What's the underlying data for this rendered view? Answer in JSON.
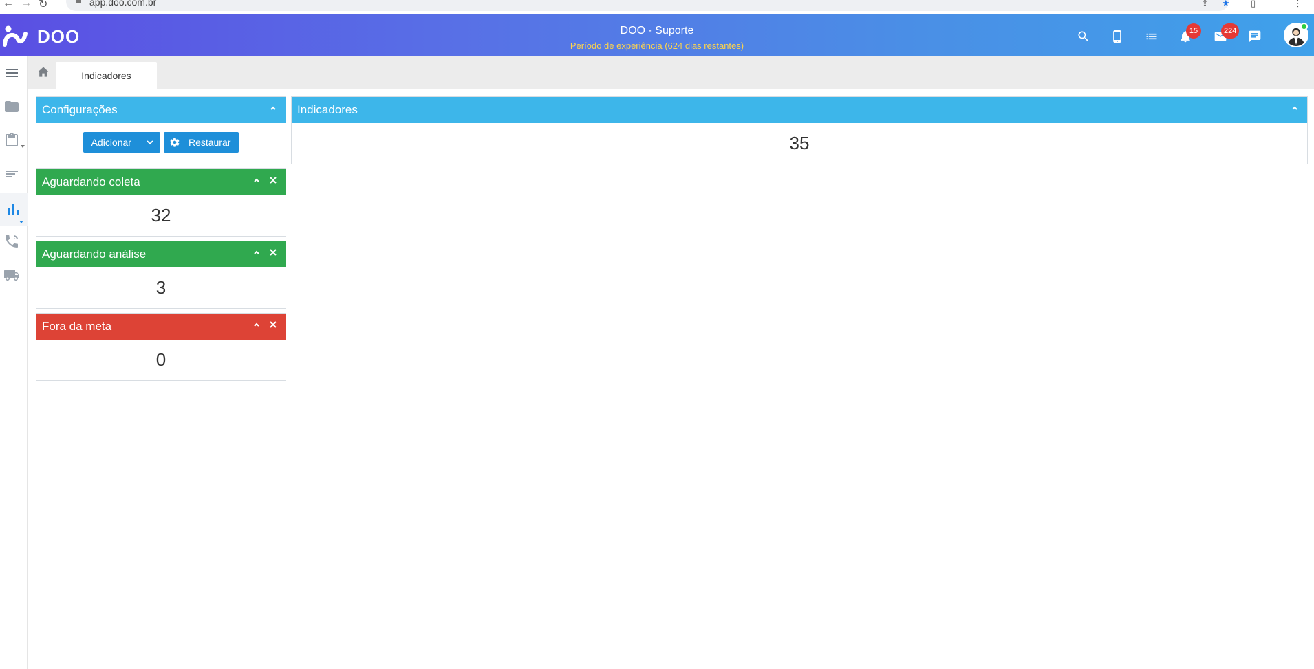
{
  "browser": {
    "url": "app.doo.com.br"
  },
  "header": {
    "logo_text": "DOO",
    "title": "DOO - Suporte",
    "trial_notice": "Período de experiência (624 dias restantes)",
    "notifications_count": "15",
    "messages_count": "224",
    "icons": [
      "search-icon",
      "mobile-icon",
      "list-icon",
      "bell-icon",
      "mail-icon",
      "chat-icon",
      "avatar"
    ]
  },
  "sidebar": {
    "items": [
      "menu-icon",
      "folder-icon",
      "clipboard-icon",
      "lines-icon",
      "bar-chart-icon",
      "phone-icon",
      "truck-icon"
    ],
    "active": "bar-chart-icon"
  },
  "tabs": [
    {
      "label": "Indicadores"
    }
  ],
  "panels": {
    "config": {
      "title": "Configurações",
      "add_label": "Adicionar",
      "restore_label": "Restaurar"
    },
    "aguardando_coleta": {
      "title": "Aguardando coleta",
      "value": "32"
    },
    "aguardando_analise": {
      "title": "Aguardando análise",
      "value": "3"
    },
    "fora_da_meta": {
      "title": "Fora da meta",
      "value": "0"
    },
    "indicadores": {
      "title": "Indicadores",
      "value": "35"
    }
  },
  "colors": {
    "header_gradient_start": "#5a4fe3",
    "header_gradient_end": "#3fa1ea",
    "panel_blue": "#3db6ea",
    "panel_green": "#30a94f",
    "panel_red": "#dd4336",
    "button_blue": "#1e8fd9",
    "badge_red": "#e53935",
    "trial_yellow": "#ffd54a"
  }
}
